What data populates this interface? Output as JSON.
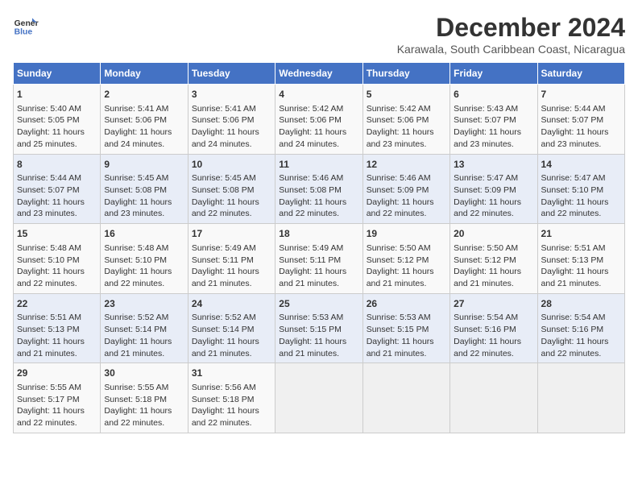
{
  "logo": {
    "line1": "General",
    "line2": "Blue"
  },
  "title": "December 2024",
  "subtitle": "Karawala, South Caribbean Coast, Nicaragua",
  "days_header": [
    "Sunday",
    "Monday",
    "Tuesday",
    "Wednesday",
    "Thursday",
    "Friday",
    "Saturday"
  ],
  "weeks": [
    [
      {
        "day": "1",
        "info": "Sunrise: 5:40 AM\nSunset: 5:05 PM\nDaylight: 11 hours\nand 25 minutes."
      },
      {
        "day": "2",
        "info": "Sunrise: 5:41 AM\nSunset: 5:06 PM\nDaylight: 11 hours\nand 24 minutes."
      },
      {
        "day": "3",
        "info": "Sunrise: 5:41 AM\nSunset: 5:06 PM\nDaylight: 11 hours\nand 24 minutes."
      },
      {
        "day": "4",
        "info": "Sunrise: 5:42 AM\nSunset: 5:06 PM\nDaylight: 11 hours\nand 24 minutes."
      },
      {
        "day": "5",
        "info": "Sunrise: 5:42 AM\nSunset: 5:06 PM\nDaylight: 11 hours\nand 23 minutes."
      },
      {
        "day": "6",
        "info": "Sunrise: 5:43 AM\nSunset: 5:07 PM\nDaylight: 11 hours\nand 23 minutes."
      },
      {
        "day": "7",
        "info": "Sunrise: 5:44 AM\nSunset: 5:07 PM\nDaylight: 11 hours\nand 23 minutes."
      }
    ],
    [
      {
        "day": "8",
        "info": "Sunrise: 5:44 AM\nSunset: 5:07 PM\nDaylight: 11 hours\nand 23 minutes."
      },
      {
        "day": "9",
        "info": "Sunrise: 5:45 AM\nSunset: 5:08 PM\nDaylight: 11 hours\nand 23 minutes."
      },
      {
        "day": "10",
        "info": "Sunrise: 5:45 AM\nSunset: 5:08 PM\nDaylight: 11 hours\nand 22 minutes."
      },
      {
        "day": "11",
        "info": "Sunrise: 5:46 AM\nSunset: 5:08 PM\nDaylight: 11 hours\nand 22 minutes."
      },
      {
        "day": "12",
        "info": "Sunrise: 5:46 AM\nSunset: 5:09 PM\nDaylight: 11 hours\nand 22 minutes."
      },
      {
        "day": "13",
        "info": "Sunrise: 5:47 AM\nSunset: 5:09 PM\nDaylight: 11 hours\nand 22 minutes."
      },
      {
        "day": "14",
        "info": "Sunrise: 5:47 AM\nSunset: 5:10 PM\nDaylight: 11 hours\nand 22 minutes."
      }
    ],
    [
      {
        "day": "15",
        "info": "Sunrise: 5:48 AM\nSunset: 5:10 PM\nDaylight: 11 hours\nand 22 minutes."
      },
      {
        "day": "16",
        "info": "Sunrise: 5:48 AM\nSunset: 5:10 PM\nDaylight: 11 hours\nand 22 minutes."
      },
      {
        "day": "17",
        "info": "Sunrise: 5:49 AM\nSunset: 5:11 PM\nDaylight: 11 hours\nand 21 minutes."
      },
      {
        "day": "18",
        "info": "Sunrise: 5:49 AM\nSunset: 5:11 PM\nDaylight: 11 hours\nand 21 minutes."
      },
      {
        "day": "19",
        "info": "Sunrise: 5:50 AM\nSunset: 5:12 PM\nDaylight: 11 hours\nand 21 minutes."
      },
      {
        "day": "20",
        "info": "Sunrise: 5:50 AM\nSunset: 5:12 PM\nDaylight: 11 hours\nand 21 minutes."
      },
      {
        "day": "21",
        "info": "Sunrise: 5:51 AM\nSunset: 5:13 PM\nDaylight: 11 hours\nand 21 minutes."
      }
    ],
    [
      {
        "day": "22",
        "info": "Sunrise: 5:51 AM\nSunset: 5:13 PM\nDaylight: 11 hours\nand 21 minutes."
      },
      {
        "day": "23",
        "info": "Sunrise: 5:52 AM\nSunset: 5:14 PM\nDaylight: 11 hours\nand 21 minutes."
      },
      {
        "day": "24",
        "info": "Sunrise: 5:52 AM\nSunset: 5:14 PM\nDaylight: 11 hours\nand 21 minutes."
      },
      {
        "day": "25",
        "info": "Sunrise: 5:53 AM\nSunset: 5:15 PM\nDaylight: 11 hours\nand 21 minutes."
      },
      {
        "day": "26",
        "info": "Sunrise: 5:53 AM\nSunset: 5:15 PM\nDaylight: 11 hours\nand 21 minutes."
      },
      {
        "day": "27",
        "info": "Sunrise: 5:54 AM\nSunset: 5:16 PM\nDaylight: 11 hours\nand 22 minutes."
      },
      {
        "day": "28",
        "info": "Sunrise: 5:54 AM\nSunset: 5:16 PM\nDaylight: 11 hours\nand 22 minutes."
      }
    ],
    [
      {
        "day": "29",
        "info": "Sunrise: 5:55 AM\nSunset: 5:17 PM\nDaylight: 11 hours\nand 22 minutes."
      },
      {
        "day": "30",
        "info": "Sunrise: 5:55 AM\nSunset: 5:18 PM\nDaylight: 11 hours\nand 22 minutes."
      },
      {
        "day": "31",
        "info": "Sunrise: 5:56 AM\nSunset: 5:18 PM\nDaylight: 11 hours\nand 22 minutes."
      },
      null,
      null,
      null,
      null
    ]
  ]
}
